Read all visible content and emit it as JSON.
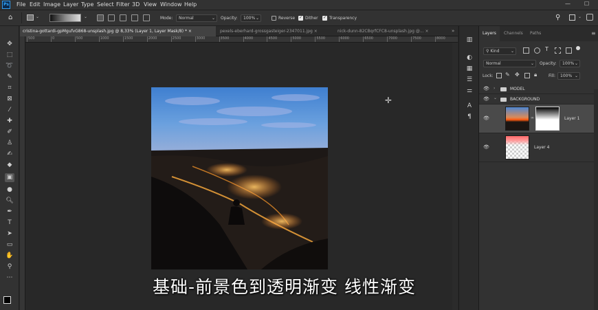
{
  "app": {
    "logo_text": "Ps"
  },
  "menu": {
    "items": [
      "File",
      "Edit",
      "Image",
      "Layer",
      "Type",
      "Select",
      "Filter",
      "3D",
      "View",
      "Window",
      "Help"
    ]
  },
  "window_controls": {
    "minimize": "—",
    "maximize": "☐"
  },
  "options": {
    "mode_label": "Mode:",
    "mode_value": "Normal",
    "opacity_label": "Opacity:",
    "opacity_value": "100%",
    "reverse_label": "Reverse",
    "dither_label": "Dither",
    "transparency_label": "Transparency",
    "reverse_checked": false,
    "dither_checked": true,
    "transparency_checked": true
  },
  "document_tabs": [
    {
      "label": "cristina-gottardi-gpMgufvG868-unsplash.jpg @ 8,33% (Layer 1, Layer Mask/8) *",
      "close": "×",
      "active": true
    },
    {
      "label": "pexels-eberhard-grossgasteiger-2347011.jpg",
      "close": "×",
      "active": false
    },
    {
      "label": "nick-dunn-82CBqrfCFC8-unsplash.jpg @...",
      "close": "×",
      "active": false
    }
  ],
  "ruler": {
    "ticks": [
      "500",
      "0",
      "500",
      "1000",
      "1500",
      "2000",
      "2500",
      "3000",
      "3500",
      "4000",
      "4500",
      "5000",
      "5500",
      "6000",
      "6500",
      "7000",
      "7500",
      "8000"
    ]
  },
  "subtitle": "基础-前景色到透明渐变 线性渐变",
  "panel": {
    "tabs": [
      "Layers",
      "Channels",
      "Paths"
    ],
    "kind_label": "Kind",
    "blend_mode": "Normal",
    "opacity_label": "Opacity:",
    "opacity_value": "100%",
    "lock_label": "Lock:",
    "fill_label": "Fill:",
    "fill_value": "100%"
  },
  "layers": [
    {
      "name": "MODEL",
      "type": "group",
      "expanded": false
    },
    {
      "name": "BACKGROUND",
      "type": "group",
      "expanded": true
    },
    {
      "name": "Layer 1",
      "type": "layer",
      "selected": true
    },
    {
      "name": "Layer 4",
      "type": "layer",
      "selected": false
    }
  ],
  "colors": {
    "accent": "#31a8ff",
    "panel_bg": "#323232",
    "canvas_bg": "#282828"
  }
}
